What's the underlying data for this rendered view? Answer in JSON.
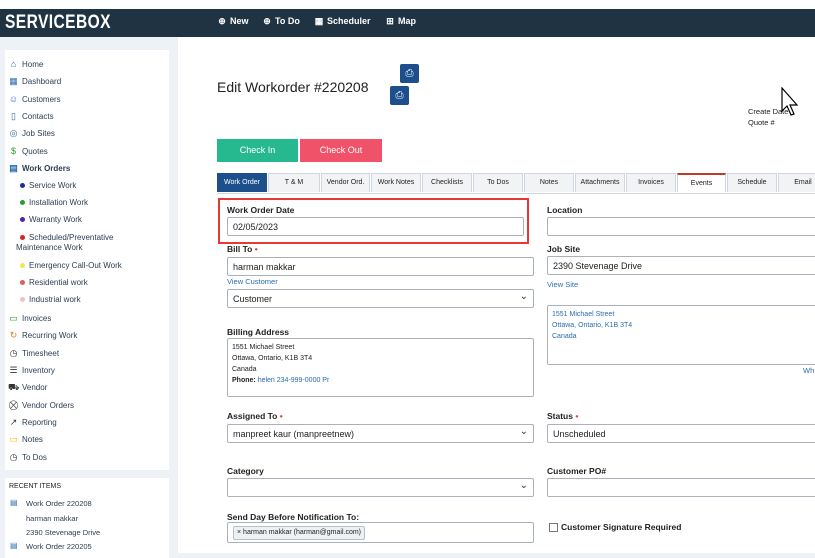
{
  "app": {
    "logo": "SERVICEBOX"
  },
  "topnav": [
    {
      "icon": "⊕",
      "label": "New"
    },
    {
      "icon": "⊕",
      "label": "To Do"
    },
    {
      "icon": "▦",
      "label": "Scheduler"
    },
    {
      "icon": "⊞",
      "label": "Map"
    }
  ],
  "sidebar": {
    "items": [
      {
        "icon": "⌂",
        "label": "Home"
      },
      {
        "icon": "▦",
        "label": "Dashboard"
      },
      {
        "icon": "☺",
        "label": "Customers"
      },
      {
        "icon": "▯",
        "label": "Contacts"
      },
      {
        "icon": "◎",
        "label": "Job Sites"
      },
      {
        "icon": "$",
        "label": "Quotes"
      },
      {
        "icon": "▤",
        "label": "Work Orders"
      }
    ],
    "sub": [
      {
        "label": "Service Work",
        "color": "#1d2f9c"
      },
      {
        "label": "Installation Work",
        "color": "#2e9b2e"
      },
      {
        "label": "Warranty Work",
        "color": "#5a1fa8"
      },
      {
        "label": "Scheduled/Preventative",
        "label2": "Maintenance Work",
        "color": "#d62424"
      },
      {
        "label": "Emergency Call-Out Work",
        "color": "#f2e55a"
      },
      {
        "label": "Residential work",
        "color": "#e05c5c"
      },
      {
        "label": "Industrial work",
        "color": "#f4c1c1"
      }
    ],
    "items2": [
      {
        "icon": "▭",
        "label": "Invoices"
      },
      {
        "icon": "↻",
        "label": "Recurring Work"
      },
      {
        "icon": "◷",
        "label": "Timesheet"
      },
      {
        "icon": "☰",
        "label": "Inventory"
      },
      {
        "icon": "⛟",
        "label": "Vendor"
      },
      {
        "icon": "⛒",
        "label": "Vendor Orders"
      },
      {
        "icon": "↗",
        "label": "Reporting"
      },
      {
        "icon": "▭",
        "label": "Notes"
      },
      {
        "icon": "◷",
        "label": "To Dos"
      }
    ]
  },
  "recent": {
    "title": "RECENT ITEMS",
    "items": [
      {
        "label": "Work Order 220208",
        "line1": "harman makkar",
        "line2": "2390 Stevenage Drive"
      },
      {
        "label": "Work Order 220205"
      }
    ]
  },
  "page": {
    "title": "Edit Workorder #220208",
    "create_date": "Create Date",
    "quote": "Quote #",
    "checkin": "Check In",
    "checkout": "Check Out"
  },
  "tabs": [
    "Work Order",
    "T & M",
    "Vendor Ord.",
    "Work Notes",
    "Checklists",
    "To Dos",
    "Notes",
    "Attachments",
    "Invoices",
    "Events",
    "Schedule",
    "Email"
  ],
  "form": {
    "wo_date_label": "Work Order Date",
    "wo_date_value": "02/05/2023",
    "location_label": "Location",
    "bill_to_label": "Bill To",
    "bill_to_value": "harman makkar",
    "view_customer": "View Customer",
    "customer_type": "Customer",
    "job_site_label": "Job Site",
    "job_site_value": "2390 Stevenage Drive",
    "view_site": "View Site",
    "site_addr": [
      "1551 Michael Street",
      "Ottawa, Ontario, K1B 3T4",
      "Canada"
    ],
    "billing_label": "Billing Address",
    "billing_addr": [
      "1551 Michael Street",
      "Ottawa, Ontario, K1B 3T4",
      "Canada"
    ],
    "phone_label": "Phone:",
    "phone_value": "helen 234-999-0000 Pr",
    "wh_link": "Wh",
    "assigned_label": "Assigned To",
    "assigned_value": "manpreet kaur (manpreetnew)",
    "status_label": "Status",
    "status_value": "Unscheduled",
    "category_label": "Category",
    "category_value": "",
    "po_label": "Customer PO#",
    "notify_label": "Send Day Before Notification To:",
    "notify_chip": "harman makkar (harman@gmail.com)",
    "signature_label": "Customer Signature Required"
  }
}
